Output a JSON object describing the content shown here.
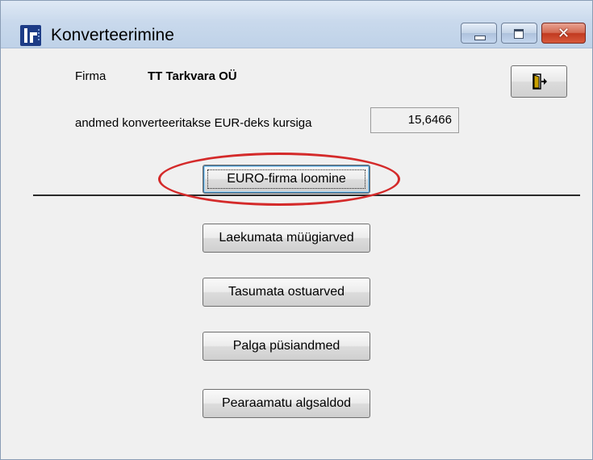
{
  "window": {
    "title": "Konverteerimine",
    "buttons": {
      "minimize": "",
      "maximize": "",
      "close": "✕"
    }
  },
  "company": {
    "label": "Firma",
    "value": "TT Tarkvara OÜ"
  },
  "conversion": {
    "label": "andmed konverteeritakse EUR-deks kursiga",
    "rate": "15,6466"
  },
  "actions": {
    "create_euro_company": "EURO-firma loomine",
    "unpaid_sales_invoices": "Laekumata müügiarved",
    "unpaid_purchase_invoices": "Tasumata ostuarved",
    "payroll_master_data": "Palga püsiandmed",
    "ledger_opening_balances": "Pearaamatu algsaldod"
  },
  "colors": {
    "annotation": "#d42a2a",
    "title_bar": "#c9d9ec",
    "close_button": "#c13a20"
  },
  "icons": {
    "app": "tt-logo-icon",
    "exit": "exit-door-icon"
  }
}
